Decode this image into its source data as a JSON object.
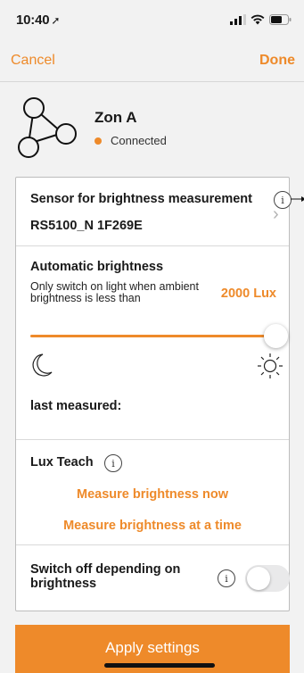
{
  "status_bar": {
    "time": "10:40",
    "location_glyph": "➚"
  },
  "nav": {
    "cancel": "Cancel",
    "done": "Done"
  },
  "device": {
    "name": "Zon A",
    "status": "Connected"
  },
  "sensor": {
    "title": "Sensor for brightness measurement",
    "value": "RS5100_N 1F269E",
    "info": "i",
    "chevron": "›"
  },
  "auto_brightness": {
    "title": "Automatic brightness",
    "description": "Only switch on light when ambient brightness is less than",
    "lux": "2000 Lux",
    "slider_level": 1.0,
    "last_measured_label": "last measured:"
  },
  "lux_teach": {
    "title": "Lux Teach",
    "info": "i",
    "measure_now": "Measure brightness now",
    "measure_at_time": "Measure brightness at a time"
  },
  "switch_off": {
    "label": "Switch off depending on brightness",
    "info": "i",
    "enabled": false
  },
  "apply_button": "Apply settings",
  "colors": {
    "accent": "#ee8a2a",
    "background": "#f2f2f2"
  },
  "icons": [
    "location-arrow-icon",
    "signal-icon",
    "wifi-icon",
    "battery-icon",
    "zone-device-icon",
    "info-icon",
    "chevron-right-icon",
    "moon-icon",
    "sun-icon"
  ]
}
